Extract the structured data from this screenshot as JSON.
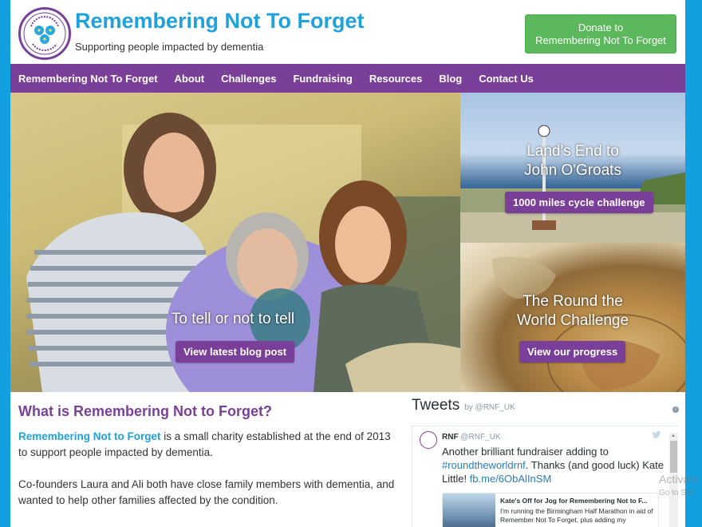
{
  "header": {
    "site_title": "Remembering Not To Forget",
    "tagline": "Supporting people impacted by dementia",
    "donate_line1": "Donate to",
    "donate_line2": "Remembering Not To Forget"
  },
  "nav": {
    "items": [
      {
        "label": "Remembering Not To Forget"
      },
      {
        "label": "About"
      },
      {
        "label": "Challenges"
      },
      {
        "label": "Fundraising"
      },
      {
        "label": "Resources"
      },
      {
        "label": "Blog"
      },
      {
        "label": "Contact Us"
      }
    ]
  },
  "hero": {
    "main": {
      "title": "To tell or not to tell",
      "button": "View latest blog post"
    },
    "side_top": {
      "title_line1": "Land's End to",
      "title_line2": "John O'Groats",
      "button": "1000 miles cycle challenge"
    },
    "side_bottom": {
      "title_line1": "The Round the",
      "title_line2": "World Challenge",
      "button": "View our progress"
    }
  },
  "content": {
    "heading": "What is Remembering Not to Forget?",
    "p1_brand": "Remembering Not to Forget",
    "p1_rest": " is a small charity established at the end of 2013 to support people impacted by dementia.",
    "p2": "Co-founders Laura and Ali both have close family members with dementia, and wanted to help other families affected by the condition."
  },
  "tweets": {
    "title": "Tweets",
    "by": "by @RNF_UK",
    "tweet": {
      "name": "RNF",
      "handle": "@RNF_UK",
      "text_1": "Another brilliant fundraiser adding to",
      "hashtag": "#roundtheworldrnf",
      "text_2": ". Thanks (and good luck) Kate Little! ",
      "link": "fb.me/6ObAlInSM"
    },
    "card": {
      "title": "Kate's Off for Jog for Remembering Not to F...",
      "desc": "I'm running the Birmingham Half Marathon in aid of Remember Not To Forget, plus adding my"
    }
  },
  "watermark": {
    "line1": "Activate",
    "line2": "Go to Sett"
  },
  "colors": {
    "brand_blue": "#1ea1dc",
    "brand_purple": "#7a3f98",
    "donate_green": "#5cb85c"
  }
}
